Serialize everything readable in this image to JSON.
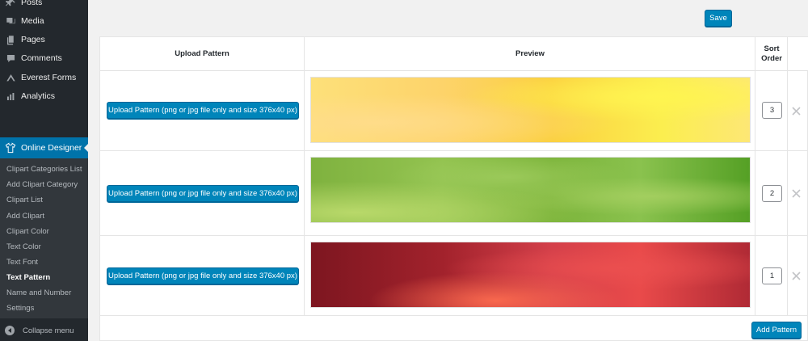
{
  "sidebar": {
    "items": [
      {
        "label": "Posts",
        "icon": "pin-icon"
      },
      {
        "label": "Media",
        "icon": "media-icon"
      },
      {
        "label": "Pages",
        "icon": "pages-icon"
      },
      {
        "label": "Comments",
        "icon": "comments-icon"
      },
      {
        "label": "Everest Forms",
        "icon": "forms-icon"
      },
      {
        "label": "Analytics",
        "icon": "analytics-icon"
      }
    ],
    "active": {
      "label": "Online Designer",
      "icon": "tshirt-icon"
    },
    "submenu": [
      "Clipart Categories List",
      "Add Clipart Category",
      "Clipart List",
      "Add Clipart",
      "Clipart Color",
      "Text Color",
      "Text Font",
      "Text Pattern",
      "Name and Number",
      "Settings"
    ],
    "current_submenu": "Text Pattern",
    "collapse_label": "Collapse menu"
  },
  "toolbar": {
    "save_label": "Save"
  },
  "table": {
    "headers": {
      "upload": "Upload Pattern",
      "preview": "Preview",
      "sort": "Sort Order"
    },
    "rows": [
      {
        "upload_label": "Upload Pattern (png or jpg file only and size 376x40 px)",
        "pattern": "yellow",
        "sort_order": "3"
      },
      {
        "upload_label": "Upload Pattern (png or jpg file only and size 376x40 px)",
        "pattern": "green",
        "sort_order": "2"
      },
      {
        "upload_label": "Upload Pattern (png or jpg file only and size 376x40 px)",
        "pattern": "red",
        "sort_order": "1"
      }
    ],
    "add_label": "Add Pattern"
  },
  "colors": {
    "accent": "#0085ba",
    "sidebar_bg": "#23282d",
    "submenu_bg": "#32373c",
    "active_bg": "#0073aa"
  }
}
